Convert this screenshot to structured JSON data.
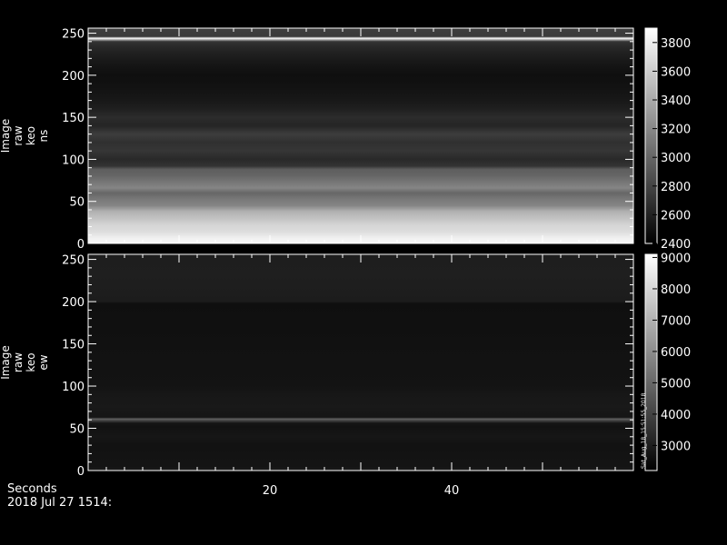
{
  "chart_data": [
    {
      "type": "heatmap",
      "ylabel_lines": [
        "Image",
        "raw",
        "keo",
        "ns"
      ],
      "xlim": [
        0,
        60
      ],
      "ylim": [
        0,
        256
      ],
      "yticks": [
        0,
        50,
        100,
        150,
        200,
        250
      ],
      "colorbar": {
        "min": 2400,
        "max": 3900,
        "ticks": [
          2400,
          2600,
          2800,
          3000,
          3200,
          3400,
          3600,
          3800
        ]
      },
      "row_profile": [
        {
          "y": 0,
          "v": 3860
        },
        {
          "y": 6,
          "v": 3820
        },
        {
          "y": 14,
          "v": 3700
        },
        {
          "y": 22,
          "v": 3650
        },
        {
          "y": 30,
          "v": 3540
        },
        {
          "y": 38,
          "v": 3440
        },
        {
          "y": 45,
          "v": 3180
        },
        {
          "y": 52,
          "v": 3120
        },
        {
          "y": 60,
          "v": 3000
        },
        {
          "y": 66,
          "v": 3180
        },
        {
          "y": 74,
          "v": 3080
        },
        {
          "y": 82,
          "v": 2980
        },
        {
          "y": 88,
          "v": 2960
        },
        {
          "y": 92,
          "v": 2700
        },
        {
          "y": 100,
          "v": 2640
        },
        {
          "y": 110,
          "v": 2720
        },
        {
          "y": 120,
          "v": 2680
        },
        {
          "y": 130,
          "v": 2760
        },
        {
          "y": 140,
          "v": 2620
        },
        {
          "y": 150,
          "v": 2660
        },
        {
          "y": 160,
          "v": 2580
        },
        {
          "y": 170,
          "v": 2540
        },
        {
          "y": 180,
          "v": 2520
        },
        {
          "y": 190,
          "v": 2500
        },
        {
          "y": 200,
          "v": 2490
        },
        {
          "y": 210,
          "v": 2520
        },
        {
          "y": 220,
          "v": 2560
        },
        {
          "y": 228,
          "v": 2600
        },
        {
          "y": 234,
          "v": 2640
        },
        {
          "y": 240,
          "v": 2700
        },
        {
          "y": 244,
          "v": 3900
        },
        {
          "y": 246,
          "v": 2740
        },
        {
          "y": 252,
          "v": 2760
        },
        {
          "y": 256,
          "v": 2760
        }
      ]
    },
    {
      "type": "heatmap",
      "ylabel_lines": [
        "Image",
        "raw",
        "keo",
        "ew"
      ],
      "xlim": [
        0,
        60
      ],
      "ylim": [
        0,
        256
      ],
      "yticks": [
        0,
        50,
        100,
        150,
        200,
        250
      ],
      "colorbar": {
        "min": 2200,
        "max": 9100,
        "ticks": [
          3000,
          4000,
          5000,
          6000,
          7000,
          8000,
          9000
        ],
        "side_label": "Sat_Aug_18_15:51:55_2018"
      },
      "row_profile": [
        {
          "y": 0,
          "v": 2900
        },
        {
          "y": 5,
          "v": 2750
        },
        {
          "y": 30,
          "v": 2700
        },
        {
          "y": 40,
          "v": 2800
        },
        {
          "y": 52,
          "v": 2700
        },
        {
          "y": 56,
          "v": 2760
        },
        {
          "y": 61,
          "v": 4800
        },
        {
          "y": 63,
          "v": 2780
        },
        {
          "y": 75,
          "v": 2880
        },
        {
          "y": 90,
          "v": 2820
        },
        {
          "y": 100,
          "v": 2720
        },
        {
          "y": 150,
          "v": 2650
        },
        {
          "y": 198,
          "v": 2600
        },
        {
          "y": 200,
          "v": 2950
        },
        {
          "y": 230,
          "v": 3050
        },
        {
          "y": 256,
          "v": 3000
        }
      ]
    }
  ],
  "x_axis": {
    "ticks": [
      20,
      40
    ]
  },
  "footer": {
    "xlabel": "Seconds",
    "date": "2018 Jul 27 1514:"
  },
  "colors": {
    "background": "#000000",
    "axis": "#ffffff"
  }
}
